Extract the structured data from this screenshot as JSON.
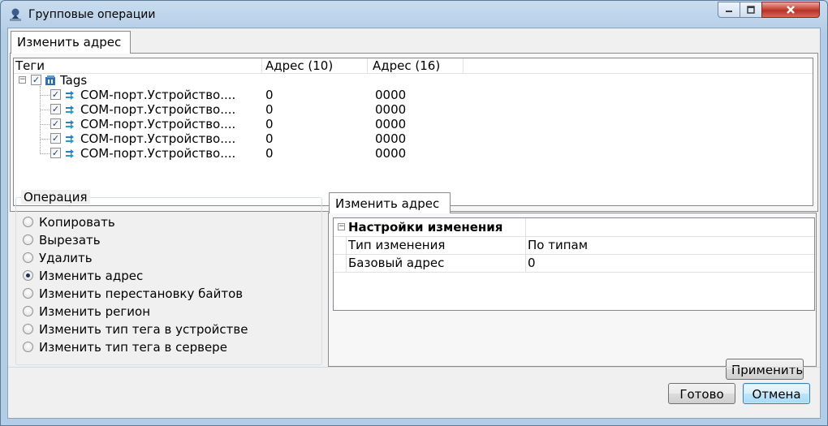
{
  "window": {
    "title": "Групповые операции"
  },
  "top_tab": {
    "label": "Изменить адрес"
  },
  "tree": {
    "columns": [
      "Теги",
      "Адрес (10)",
      "Адрес (16)"
    ],
    "root": {
      "label": "Tags",
      "checked": true
    },
    "rows": [
      {
        "name": "COM-порт.Устройство....",
        "addr10": "0",
        "addr16": "0000"
      },
      {
        "name": "COM-порт.Устройство....",
        "addr10": "0",
        "addr16": "0000"
      },
      {
        "name": "COM-порт.Устройство....",
        "addr10": "0",
        "addr16": "0000"
      },
      {
        "name": "COM-порт.Устройство....",
        "addr10": "0",
        "addr16": "0000"
      },
      {
        "name": "COM-порт.Устройство....",
        "addr10": "0",
        "addr16": "0000"
      }
    ]
  },
  "operation": {
    "group_label": "Операция",
    "options": [
      {
        "label": "Копировать",
        "selected": false
      },
      {
        "label": "Вырезать",
        "selected": false
      },
      {
        "label": "Удалить",
        "selected": false
      },
      {
        "label": "Изменить адрес",
        "selected": true
      },
      {
        "label": "Изменить перестановку байтов",
        "selected": false
      },
      {
        "label": "Изменить регион",
        "selected": false
      },
      {
        "label": "Изменить тип тега в устройстве",
        "selected": false
      },
      {
        "label": "Изменить тип тега в сервере",
        "selected": false
      }
    ]
  },
  "right_tab": {
    "label": "Изменить адрес"
  },
  "settings": {
    "section_title": "Настройки изменения",
    "rows": [
      {
        "key": "Тип изменения",
        "value": "По типам"
      },
      {
        "key": "Базовый адрес",
        "value": "0"
      }
    ]
  },
  "buttons": {
    "apply": "Применить",
    "done": "Готово",
    "cancel": "Отмена"
  },
  "icons": {
    "app": "app-logo-icon",
    "root": "tags-folder-icon",
    "tag": "tag-arrows-icon"
  },
  "colors": {
    "accent": "#3c7fb1",
    "check": "#1b3f8a"
  }
}
